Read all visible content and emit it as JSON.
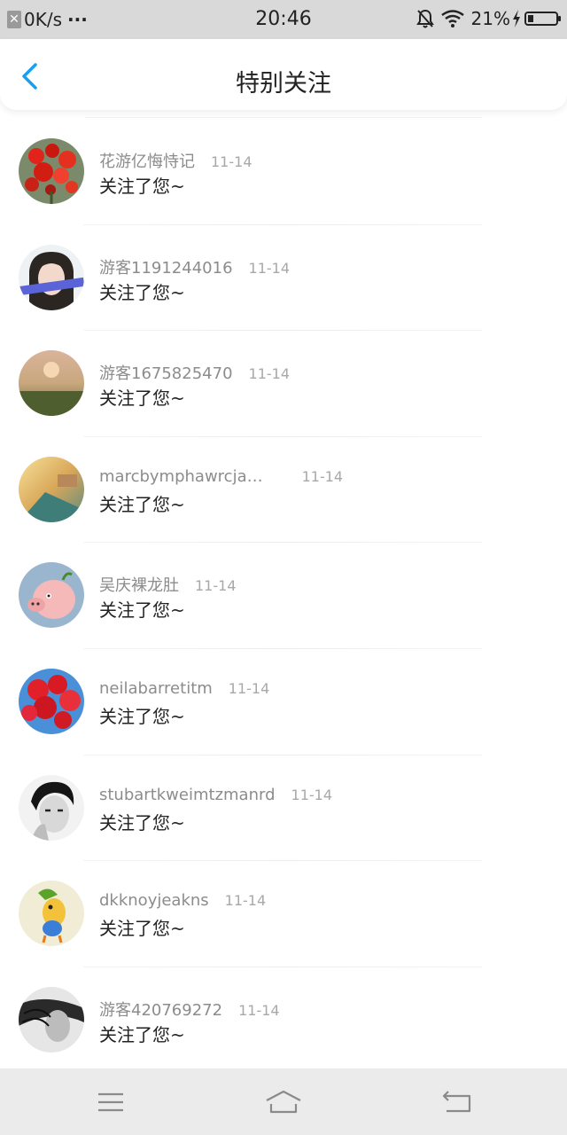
{
  "status_bar": {
    "network_speed": "0K/s",
    "more": "···",
    "time": "20:46",
    "battery_percent": "21%",
    "battery_level": 0.21
  },
  "header": {
    "title": "特别关注"
  },
  "list": [
    {
      "username": "花游亿悔恃记",
      "date": "11-14",
      "action": "关注了您~",
      "avatar": "red-flowers"
    },
    {
      "username": "游客1191244016",
      "date": "11-14",
      "action": "关注了您~",
      "avatar": "girl-portrait"
    },
    {
      "username": "游客1675825470",
      "date": "11-14",
      "action": "关注了您~",
      "avatar": "sunset-field"
    },
    {
      "username": "marcbymphawrcja…",
      "date": "11-14",
      "action": "关注了您~",
      "avatar": "sunlit-street"
    },
    {
      "username": "吴庆裸龙肚",
      "date": "11-14",
      "action": "关注了您~",
      "avatar": "cartoon-pig"
    },
    {
      "username": "neilabarretitm",
      "date": "11-14",
      "action": "关注了您~",
      "avatar": "red-balloons"
    },
    {
      "username": "stubartkweimtzmanrd",
      "date": "11-14",
      "action": "关注了您~",
      "avatar": "bw-man-portrait"
    },
    {
      "username": "dkknoyjeakns",
      "date": "11-14",
      "action": "关注了您~",
      "avatar": "cartoon-bird"
    },
    {
      "username": "游客420769272",
      "date": "11-14",
      "action": "关注了您~",
      "avatar": "bw-windy-portrait"
    }
  ],
  "colors": {
    "accent": "#1a9ff0",
    "status_bar_bg": "#d9d9d9",
    "nav_bar_bg": "#ebebeb",
    "username": "#8c8c8c",
    "date": "#a8a8a8",
    "text": "#222222"
  }
}
